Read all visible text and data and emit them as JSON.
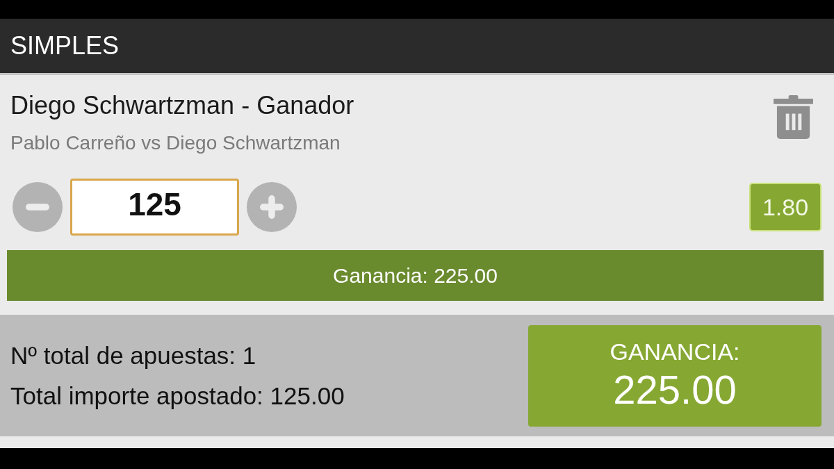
{
  "header": {
    "title": "SIMPLES"
  },
  "bets": [
    {
      "selection": "Diego Schwartzman - Ganador",
      "event": "Pablo Carreño vs Diego Schwartzman",
      "stake": "125",
      "odds": "1.80",
      "winnings": "Ganancia: 225.00"
    }
  ],
  "summary": {
    "lines": [
      "Nº total de apuestas: 1",
      "Total importe apostado: 125.00"
    ],
    "payout_label": "GANANCIA:",
    "payout_value": "225.00"
  }
}
